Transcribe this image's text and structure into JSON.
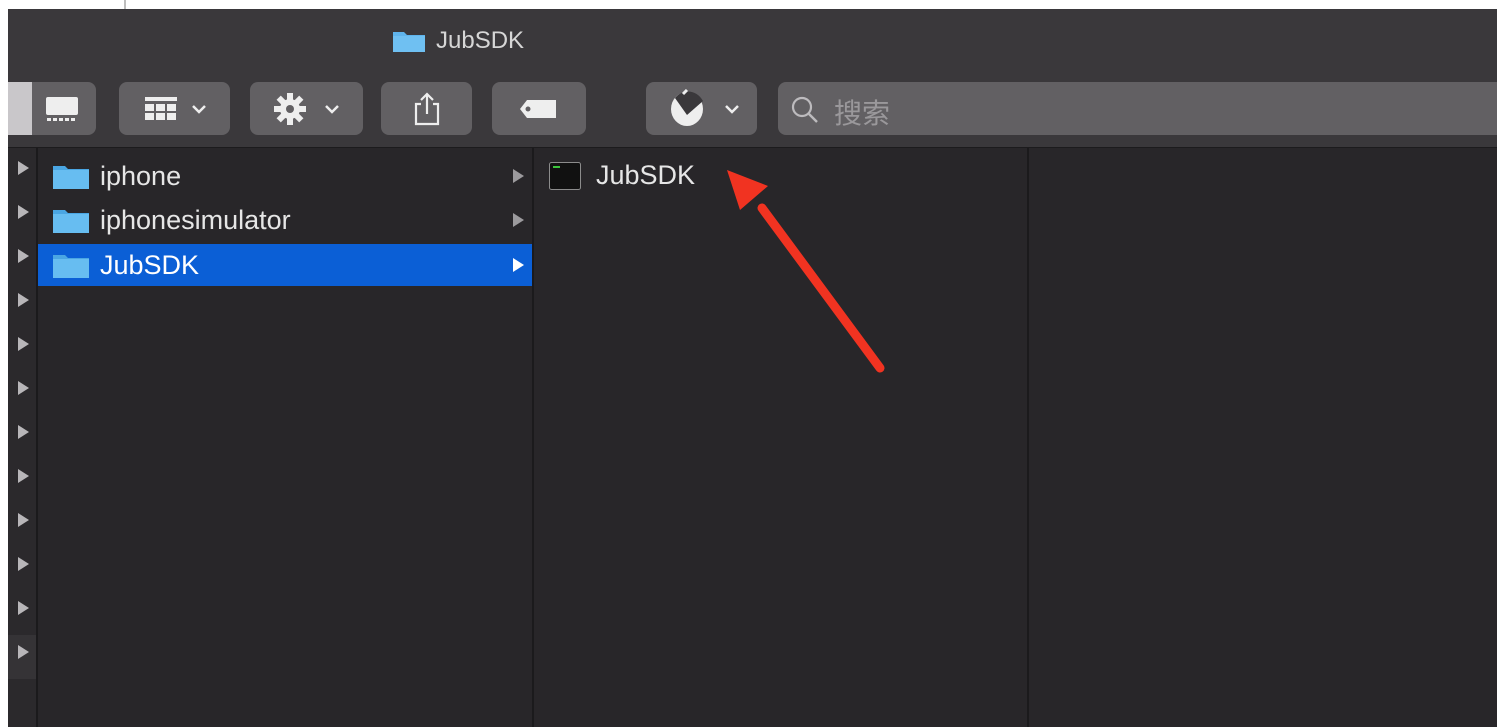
{
  "window": {
    "title": "JubSDK"
  },
  "search": {
    "placeholder": "搜索"
  },
  "columns": {
    "first": [
      {
        "name": "iphone",
        "selected": false
      },
      {
        "name": "iphonesimulator",
        "selected": false
      },
      {
        "name": "JubSDK",
        "selected": true
      }
    ],
    "second": [
      {
        "name": "JubSDK",
        "kind": "unix-executable-icon"
      }
    ]
  },
  "toolbar": {
    "icons": [
      "cover-flow-icon",
      "group-view-icon",
      "gear-icon",
      "share-icon",
      "tag-icon",
      "acorn-app-icon",
      "search-icon"
    ]
  },
  "colors": {
    "selection": "#0b5fd6",
    "folder": "#5fb4ec",
    "annotation_arrow": "#f13321"
  }
}
